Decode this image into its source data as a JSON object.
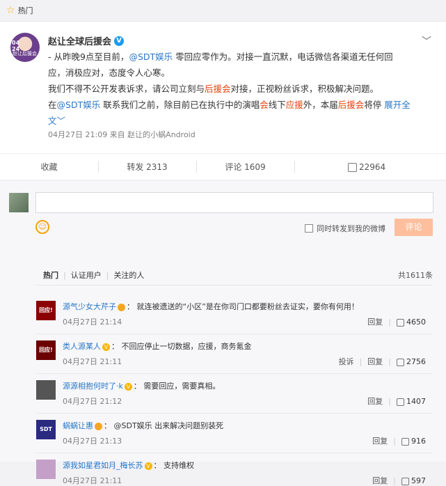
{
  "header": {
    "label": "热门"
  },
  "post": {
    "author": "赵让全球后援会",
    "avatar": {
      "date": "04\n24",
      "caption": "赵让后援会"
    },
    "lines": [
      [
        {
          "t": "- 从昨晚9点至目前，"
        },
        {
          "t": "@SDT娱乐",
          "c": "link"
        },
        {
          "t": " 零回应零作为。对接一直沉默，电话微信各渠道无任何回"
        }
      ],
      [
        {
          "t": "应，消极应对，态度令人心寒。"
        }
      ],
      [
        {
          "t": "我们不得不公开发表诉求，请公司立刻与"
        },
        {
          "t": "后援会",
          "c": "red"
        },
        {
          "t": "对接，正视粉丝诉求，积极解决问题。"
        }
      ],
      [
        {
          "t": "在"
        },
        {
          "t": "@SDT娱乐",
          "c": "link"
        },
        {
          "t": " 联系我们之前，除目前已在执行中的演唱"
        },
        {
          "t": "会",
          "c": "red"
        },
        {
          "t": "线下"
        },
        {
          "t": "应援",
          "c": "red"
        },
        {
          "t": "外，本届"
        },
        {
          "t": "后援会",
          "c": "red"
        },
        {
          "t": "将停 "
        },
        {
          "t": "展开全",
          "c": "link"
        }
      ],
      [
        {
          "t": "文﹀",
          "c": "link"
        }
      ]
    ],
    "meta": "04月27日 21:09  来自 赵让的小蜗Android"
  },
  "actions": {
    "collect": "收藏",
    "repost": "转发 2313",
    "comment": "评论 1609",
    "like": "22964"
  },
  "composer": {
    "checkbox_label": "同时转发到我的微博",
    "submit_label": "评论"
  },
  "comments_header": {
    "tabs": [
      "热门",
      "认证用户",
      "关注的人"
    ],
    "total": "共1611条"
  },
  "comments": [
    {
      "user": "源气少女大芹子",
      "badge": "icon",
      "text": "就连被遗送的“小区”是在你司门口都要粉丝去证实，要你有何用！",
      "date": "04月27日 21:14",
      "ops": [
        "回复"
      ],
      "likes": "4650",
      "avatar_color": "#8b0000",
      "avatar_text": "回应!"
    },
    {
      "user": "类人源某人",
      "badge": "v",
      "text": "不回应停止一切数据，应援，商务氪金",
      "date": "04月27日 21:11",
      "ops": [
        "投诉",
        "回复"
      ],
      "likes": "2756",
      "avatar_color": "#6b0000",
      "avatar_text": "回应!"
    },
    {
      "user": "源源相抱何时了·k",
      "badge": "v",
      "text": "需要回应，需要真相。",
      "date": "04月27日 21:12",
      "ops": [
        "回复"
      ],
      "likes": "1407",
      "avatar_color": "#555",
      "avatar_text": ""
    },
    {
      "user": "蜗蜗让惠",
      "badge": "icon",
      "text": "@SDT娱乐 出来解决问题别装死",
      "date": "04月27日 21:13",
      "ops": [
        "回复"
      ],
      "likes": "916",
      "avatar_color": "#2a2a80",
      "avatar_text": "SDT"
    },
    {
      "user": "源我如星君如月_梅长苏",
      "badge": "v",
      "text": "支持维权",
      "date": "04月27日 21:11",
      "ops": [
        "回复"
      ],
      "likes": "597",
      "avatar_color": "#c4a0c8",
      "avatar_text": ""
    }
  ]
}
